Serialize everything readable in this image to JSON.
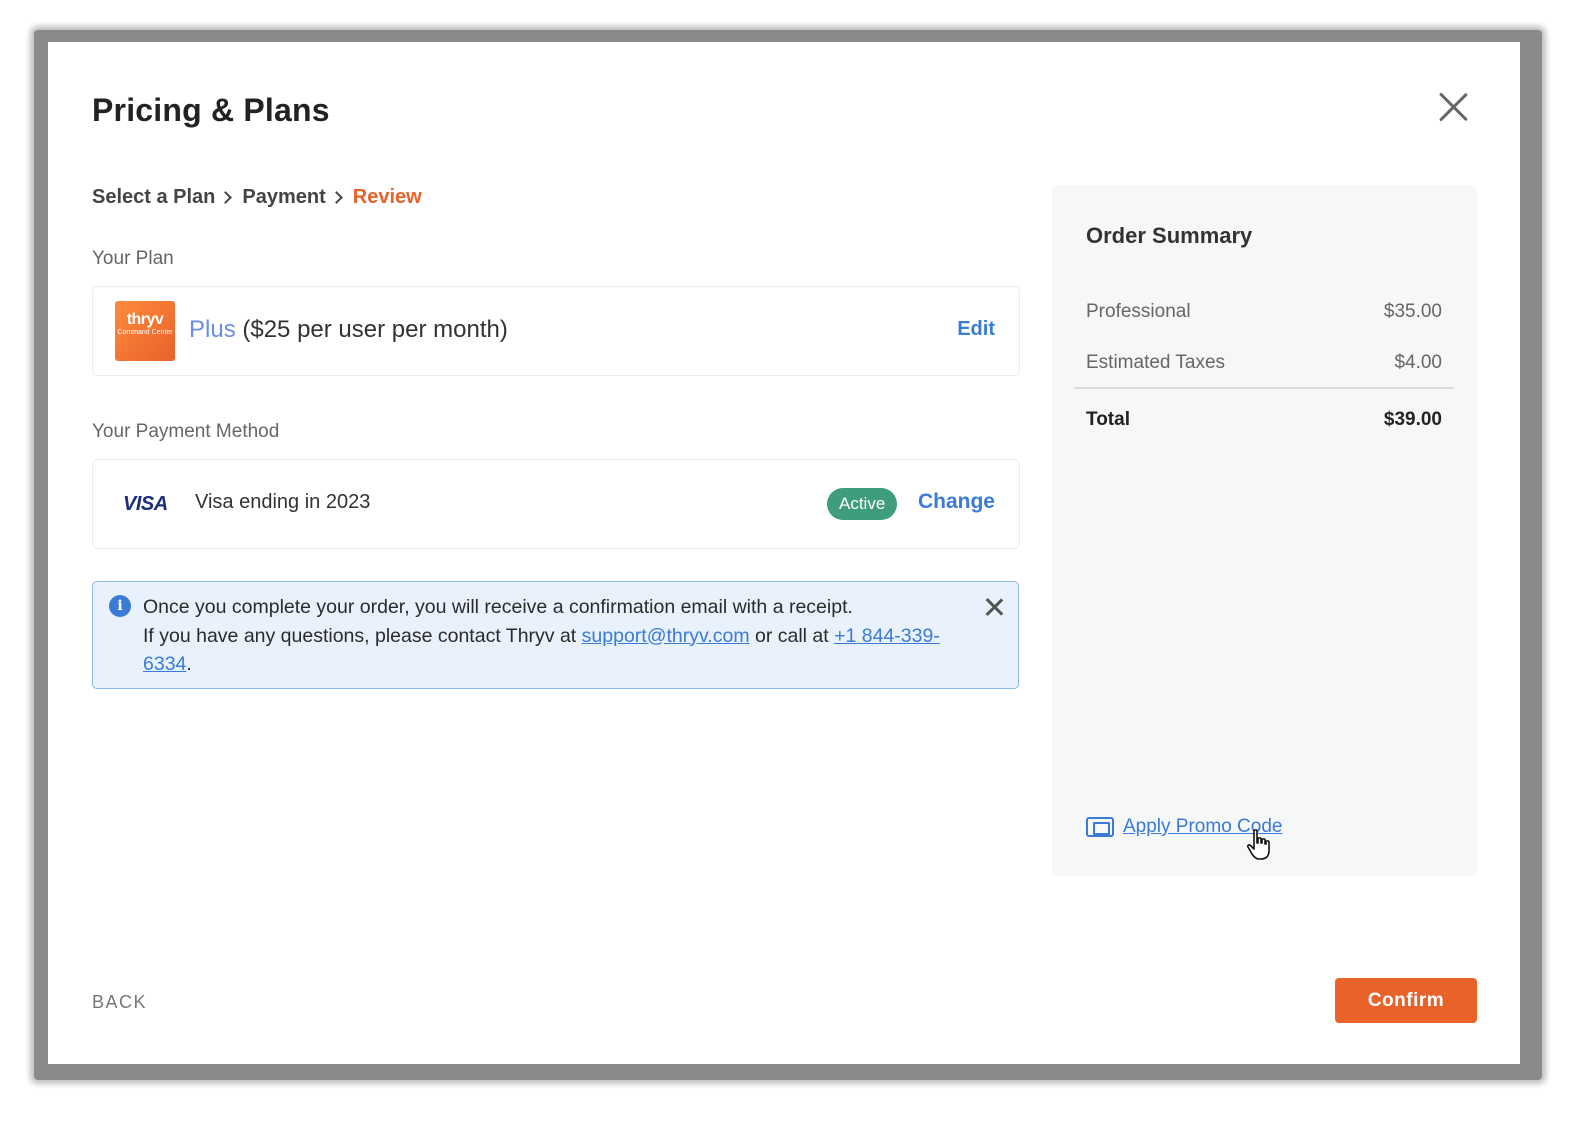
{
  "modal": {
    "title": "Pricing & Plans"
  },
  "breadcrumb": {
    "steps": [
      "Select a Plan",
      "Payment",
      "Review"
    ],
    "active": "Review"
  },
  "plan": {
    "section_label": "Your Plan",
    "logo_text": "thryv",
    "logo_subtext": "Command Center",
    "name": "Plus",
    "price_detail": "($25 per user per month)",
    "edit_label": "Edit"
  },
  "payment": {
    "section_label": "Your Payment Method",
    "card_brand": "VISA",
    "description": "Visa ending in 2023",
    "status": "Active",
    "change_label": "Change"
  },
  "alert": {
    "line1": "Once you complete your order, you will receive a confirmation email with a receipt.",
    "line2_pre": "If you have any questions, please contact Thryv at ",
    "email": "support@thryv.com",
    "line2_mid": " or call at ",
    "phone": "+1 844-339-6334",
    "line2_end": "."
  },
  "summary": {
    "title": "Order Summary",
    "items": [
      {
        "label": "Professional",
        "amount": "$35.00"
      },
      {
        "label": "Estimated Taxes",
        "amount": "$4.00"
      }
    ],
    "total_label": "Total",
    "total_amount": "$39.00",
    "promo_label": "Apply Promo Code"
  },
  "footer": {
    "back_label": "BACK",
    "confirm_label": "Confirm"
  },
  "colors": {
    "accent": "#e8622a",
    "link": "#3a7bd5",
    "success": "#3f9c7e",
    "info_bg": "#e8f1fc"
  }
}
